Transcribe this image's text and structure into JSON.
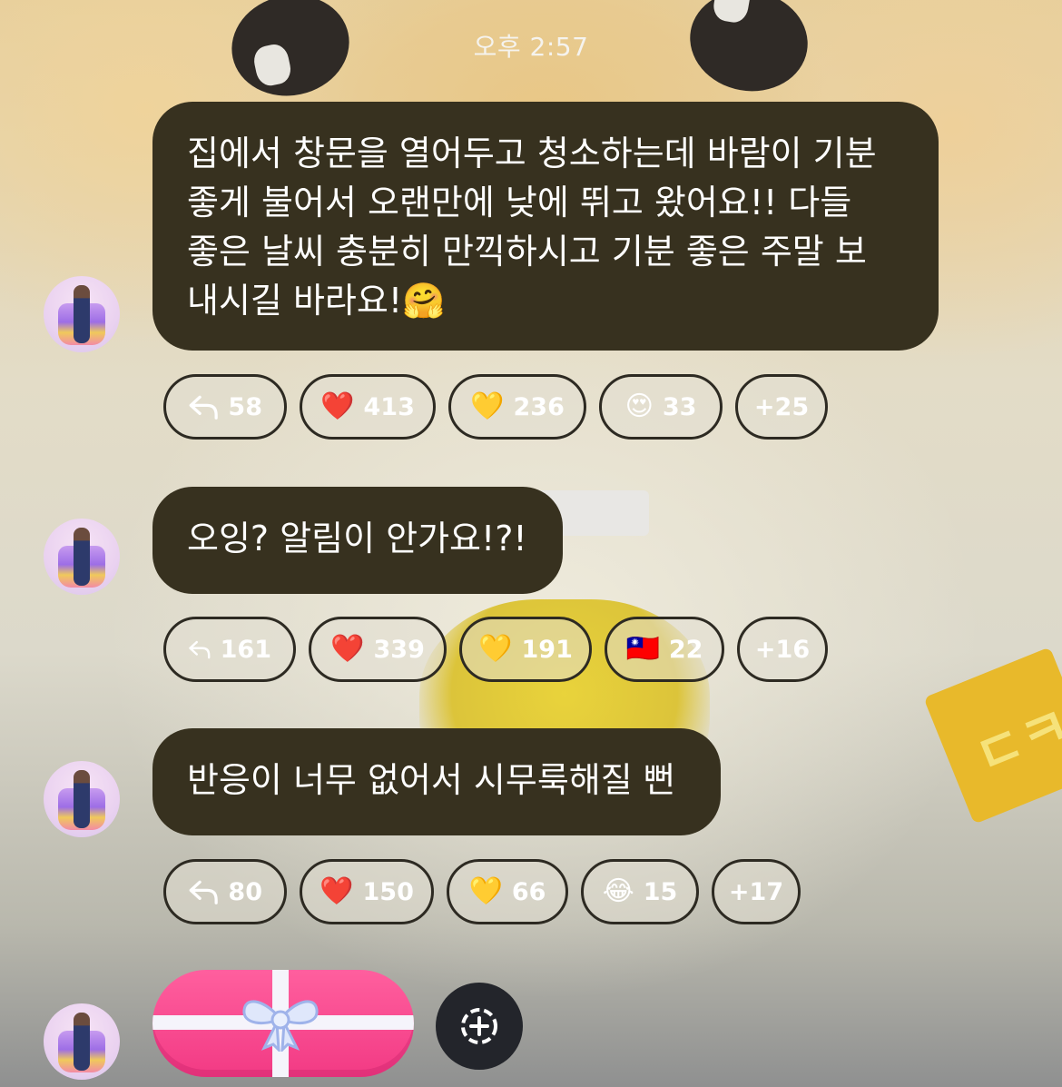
{
  "timestamp": "오후 2:57",
  "colors": {
    "bubble": "#37311f",
    "chip_border": "#2d2a22",
    "gift_pink": "#f23a84",
    "add_button": "#23252b"
  },
  "messages": [
    {
      "text": "집에서 창문을 열어두고 청소하는데 바람이 기분\n좋게 불어서 오랜만에 낮에 뛰고 왔어요!! 다들\n좋은 날씨 충분히 만끽하시고 기분 좋은 주말 보\n내시길 바라요!🤗",
      "reactions": {
        "replies": "58",
        "heart_emoji": "❤️",
        "heart": "413",
        "yellow_emoji": "💛",
        "yellow": "236",
        "third_emoji": "😍",
        "third": "33",
        "more": "+25"
      }
    },
    {
      "text": "오잉? 알림이 안가요!?!",
      "reactions": {
        "replies": "161",
        "heart_emoji": "❤️",
        "heart": "339",
        "yellow_emoji": "💛",
        "yellow": "191",
        "third_emoji": "🇹🇼",
        "third": "22",
        "more": "+16"
      }
    },
    {
      "text": "반응이 너무 없어서 시무룩해질 뻔",
      "reactions": {
        "replies": "80",
        "heart_emoji": "❤️",
        "heart": "150",
        "yellow_emoji": "💛",
        "yellow": "66",
        "third_emoji": "😂",
        "third": "15",
        "more": "+17"
      }
    }
  ],
  "icons": {
    "reply": "reply-arrow-icon",
    "gift": "gift-ribbon-icon",
    "add": "add-reaction-icon"
  }
}
